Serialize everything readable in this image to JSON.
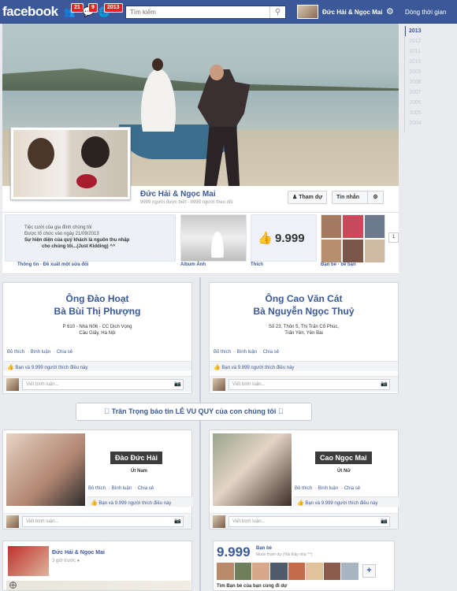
{
  "topbar": {
    "logo": "facebook",
    "friend_requests_count": "21",
    "messages_count": "9",
    "notifications_count": "2013",
    "search_placeholder": "Tìm kiếm",
    "user_name": "Đức Hải & Ngọc Mai",
    "timeline_link": "Dòng thời gian"
  },
  "years": [
    "2013",
    "2012",
    "2011",
    "2010",
    "2009",
    "2008",
    "2007",
    "2006",
    "2005",
    "2004"
  ],
  "profile": {
    "name": "Đức Hải & Ngọc Mai",
    "subtitle": "9999 người được biết - 9999 người theo dõi",
    "follow_button": "Tham dự",
    "message_button": "Tin nhắn"
  },
  "about": {
    "line1": "Tiệc cưới của gia đình chúng tôi",
    "line2": "Được tổ chức vào ngày 21/09/2013",
    "line3": "Sự hiện diện của quý khách là nguồn thu nhập",
    "line4": "cho chúng tôi...(Just Kidding) ^^",
    "info_tab": "Thông tin · Đề xuất một sửa đổi",
    "album_tab": "Album Ảnh",
    "likes_tab": "Thích",
    "likes_count": "9.999",
    "friends_tab": "Bạn bè · bè bạn",
    "more": "1"
  },
  "posts": {
    "left_family": {
      "title1": "Ông Đào Hoạt",
      "title2": "Bà Bùi Thị Phượng",
      "addr1": "P 610 - Nhà N06 - CC Dịch Vọng",
      "addr2": "Cầu Giấy, Hà Nội"
    },
    "right_family": {
      "title1": "Ông Cao Văn Cát",
      "title2": "Bà Nguyễn Ngọc Thuỷ",
      "addr1": "Số 23, Thôn 5, Thị Trấn Cổ Phúc,",
      "addr2": "Trấn Yên, Yên Bái"
    },
    "like_action": "Bỏ thích",
    "comment_action": "Bình luận",
    "share_action": "Chia sẻ",
    "likes_text": "Bạn và 9.999 người thích điều này",
    "comment_placeholder": "Viết bình luận..."
  },
  "announcement": "Trân Trọng báo tin LỄ VU QUY của con chúng tôi",
  "groom": {
    "name": "Đào Đức Hải",
    "role": "Út Nam"
  },
  "bride": {
    "name": "Cao Ngọc Mai",
    "role": "Út Nữ"
  },
  "footer_post": {
    "name": "Đức Hải & Ngọc Mai",
    "time": "3 giờ trước"
  },
  "friends_card": {
    "count": "9.999",
    "label": "Bạn bè",
    "sub": "Muốn tham dự (Hải thầy nhà ^^)",
    "find": "Tìm Bạn bè của bạn cùng đi dự"
  },
  "colors": {
    "brand": "#3b5998",
    "badge": "#e02424",
    "background": "#e9ebee"
  }
}
